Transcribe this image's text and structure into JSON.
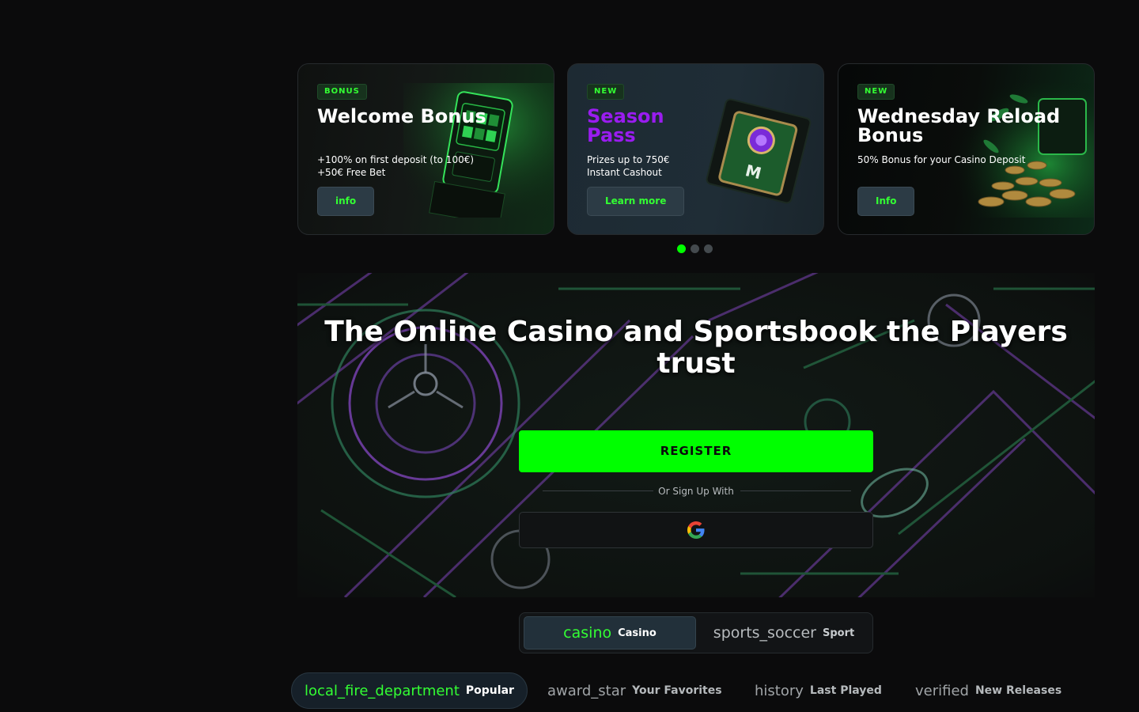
{
  "promos": [
    {
      "badge": "BONUS",
      "title": "Welcome Bonus",
      "desc_line1": "+100% on first deposit (to 100€)",
      "desc_line2": "+50€ Free Bet",
      "button": "info"
    },
    {
      "badge": "NEW",
      "title": "Season Pass",
      "desc_line1": "Prizes up to 750€",
      "desc_line2": "Instant Cashout",
      "button": "Learn more"
    },
    {
      "badge": "NEW",
      "title": "Wednesday Reload Bonus",
      "desc_line1": "50% Bonus for your Casino Deposit",
      "desc_line2": "",
      "button": "Info"
    }
  ],
  "carousel": {
    "slides": 3,
    "active_index": 0
  },
  "hero": {
    "title": "The Online Casino and Sportsbook the Players trust",
    "register_button": "REGISTER",
    "signup_with": "Or Sign Up With"
  },
  "mode_toggle": {
    "casino": {
      "icon": "casino",
      "label": "Casino"
    },
    "sport": {
      "icon": "sports_soccer",
      "label": "Sport"
    }
  },
  "categories": [
    {
      "icon": "local_fire_department",
      "label": "Popular"
    },
    {
      "icon": "award_star",
      "label": "Your Favorites"
    },
    {
      "icon": "history",
      "label": "Last Played"
    },
    {
      "icon": "verified",
      "label": "New Releases"
    }
  ],
  "colors": {
    "accent": "#00ff00",
    "season_pass_title": "#9a1cf0",
    "background": "#0b0b0c"
  }
}
